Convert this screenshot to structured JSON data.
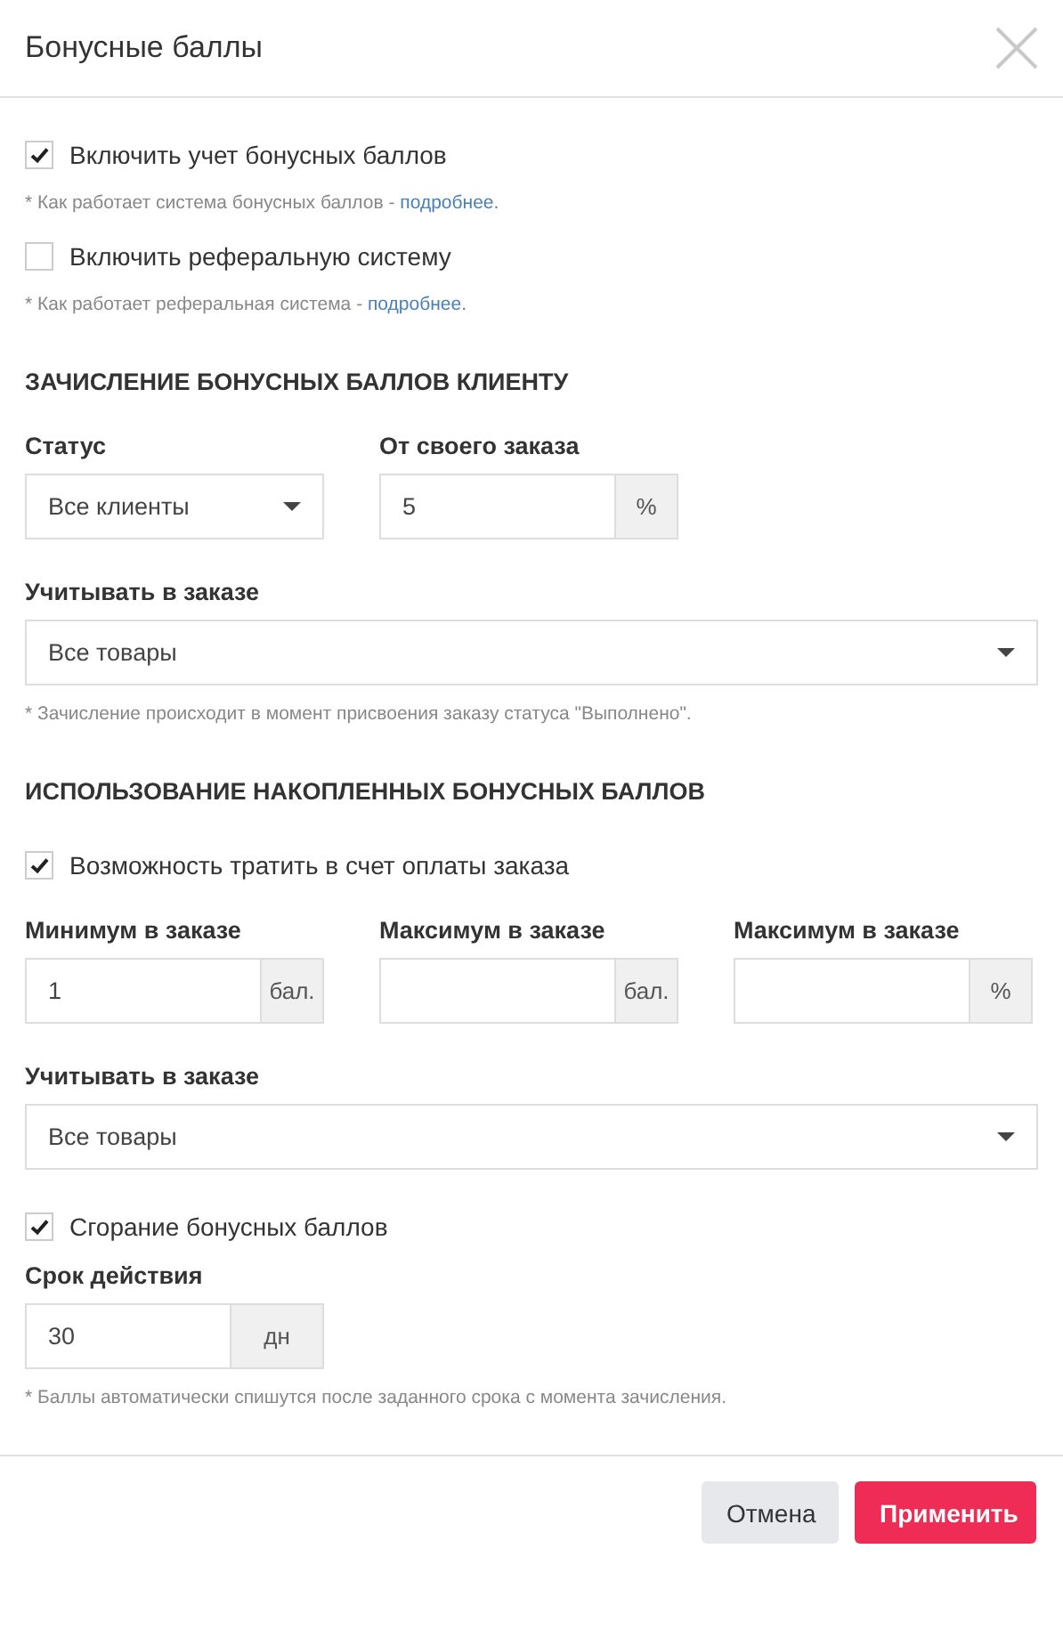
{
  "dialog": {
    "title": "Бонусные баллы"
  },
  "options": [
    {
      "label": "Включить учет бонусных баллов",
      "checked": true,
      "note": "* Как работает система бонусных баллов - ",
      "link": "подробнее."
    },
    {
      "label": "Включить реферальную систему",
      "checked": false,
      "note": "* Как работает реферальная система - ",
      "link": "подробнее."
    }
  ],
  "accrual": {
    "heading": "ЗАЧИСЛЕНИЕ БОНУСНЫХ БАЛЛОВ КЛИЕНТУ",
    "status": {
      "label": "Статус",
      "value": "Все клиенты"
    },
    "own_order": {
      "label": "От своего заказа",
      "value": "5",
      "suffix": "%"
    },
    "count_in_order": {
      "label": "Учитывать в заказе",
      "value": "Все товары"
    },
    "note": "* Зачисление происходит в момент присвоения заказу статуса \"Выполнено\"."
  },
  "usage": {
    "heading": "ИСПОЛЬЗОВАНИЕ НАКОПЛЕННЫХ БОНУСНЫХ БАЛЛОВ",
    "spend": {
      "label": "Возможность тратить в счет оплаты заказа",
      "checked": true
    },
    "limits": [
      {
        "label": "Минимум в заказе",
        "value": "1",
        "suffix": "бал."
      },
      {
        "label": "Максимум в заказе",
        "suffix": "бал."
      },
      {
        "label": "Максимум в заказе",
        "suffix": "%"
      }
    ],
    "count_in_order": {
      "label": "Учитывать в заказе",
      "value": "Все товары"
    },
    "expiry": {
      "label": "Сгорание бонусных баллов",
      "checked": true
    },
    "validity": {
      "label": "Срок действия",
      "value": "30",
      "suffix": "дн"
    },
    "note": "* Баллы автоматически спишутся после заданного срока с момента зачисления."
  },
  "buttons": [
    {
      "label": "Отмена",
      "kind": "secondary"
    },
    {
      "label": "Применить",
      "kind": "primary"
    }
  ]
}
